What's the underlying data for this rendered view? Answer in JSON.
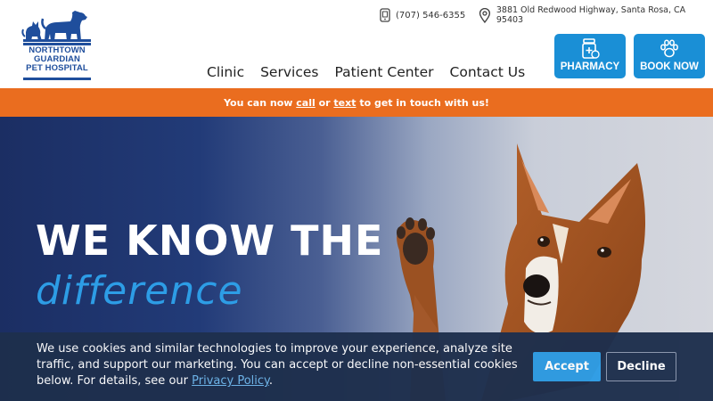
{
  "logo": {
    "line1": "NORTHTOWN",
    "line2": "GUARDIAN",
    "line3": "PET HOSPITAL",
    "icon": "dog-and-cat-icon",
    "color": "#1f4e9c"
  },
  "contact": {
    "phone": "(707) 546-6355",
    "phone_icon": "phone-icon",
    "address": "3881 Old Redwood Highway, Santa Rosa, CA 95403",
    "address_icon": "map-pin-icon"
  },
  "nav": {
    "items": [
      "Clinic",
      "Services",
      "Patient Center",
      "Contact Us"
    ]
  },
  "cta": {
    "pharmacy_label": "PHARMACY",
    "pharmacy_icon": "medicine-bottle-icon",
    "book_label": "BOOK NOW",
    "book_icon": "paw-icon",
    "color": "#1a8fd6"
  },
  "banner": {
    "prefix": "You can now ",
    "call": "call",
    "or": " or ",
    "text": "text",
    "suffix": " to get in touch with us!",
    "color": "#ea6d1f"
  },
  "hero": {
    "title": "WE KNOW THE",
    "subtitle": "difference",
    "image": "dog-raising-paw"
  },
  "cookie": {
    "text": "We use cookies and similar technologies to improve your experience, analyze site traffic, and support our marketing. You can accept or decline non-essential cookies below. For details, see our ",
    "link": "Privacy Policy",
    "end": ".",
    "accept": "Accept",
    "decline": "Decline"
  }
}
